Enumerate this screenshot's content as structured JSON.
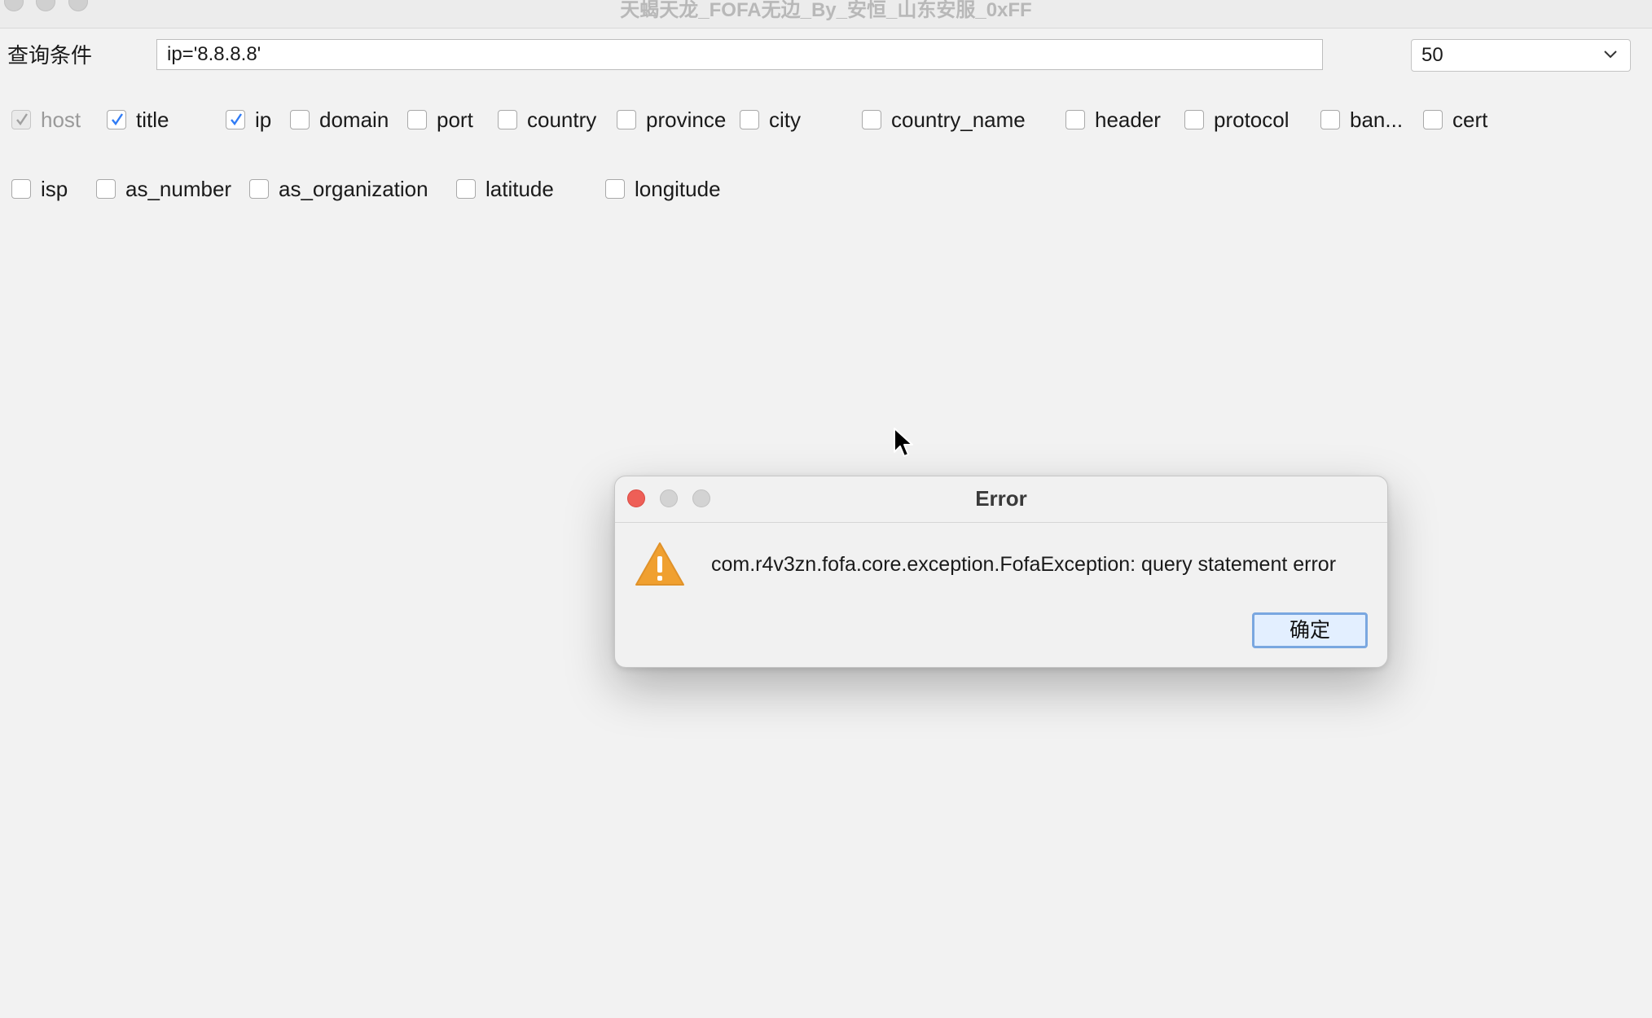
{
  "window": {
    "title": "天蝎天龙_FOFA无边_By_安恒_山东安服_0xFF"
  },
  "query": {
    "label": "查询条件",
    "value": "ip='8.8.8.8'"
  },
  "size_select": {
    "selected": "50"
  },
  "fields_row1": [
    {
      "label": "host",
      "checked": true,
      "disabled": true
    },
    {
      "label": "title",
      "checked": true,
      "disabled": false
    },
    {
      "label": "ip",
      "checked": true,
      "disabled": false
    },
    {
      "label": "domain",
      "checked": false,
      "disabled": false
    },
    {
      "label": "port",
      "checked": false,
      "disabled": false
    },
    {
      "label": "country",
      "checked": false,
      "disabled": false
    },
    {
      "label": "province",
      "checked": false,
      "disabled": false
    },
    {
      "label": "city",
      "checked": false,
      "disabled": false
    },
    {
      "label": "country_name",
      "checked": false,
      "disabled": false
    },
    {
      "label": "header",
      "checked": false,
      "disabled": false
    },
    {
      "label": "protocol",
      "checked": false,
      "disabled": false
    },
    {
      "label": "ban...",
      "checked": false,
      "disabled": false
    },
    {
      "label": "cert",
      "checked": false,
      "disabled": false
    }
  ],
  "fields_row2": [
    {
      "label": "isp",
      "checked": false,
      "disabled": false
    },
    {
      "label": "as_number",
      "checked": false,
      "disabled": false
    },
    {
      "label": "as_organization",
      "checked": false,
      "disabled": false
    },
    {
      "label": "latitude",
      "checked": false,
      "disabled": false
    },
    {
      "label": "longitude",
      "checked": false,
      "disabled": false
    }
  ],
  "dialog": {
    "title": "Error",
    "message": "com.r4v3zn.fofa.core.exception.FofaException: query statement error",
    "ok_label": "确定",
    "icon": "warning-icon"
  },
  "colors": {
    "accent": "#2f7bf5",
    "warning": "#f0a030",
    "close": "#ee5f57"
  }
}
